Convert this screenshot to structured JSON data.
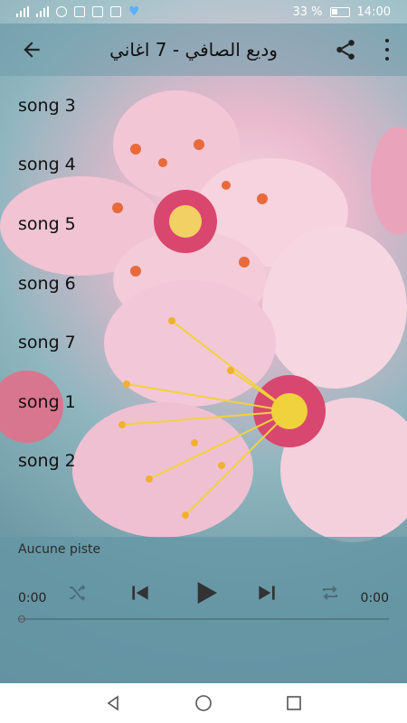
{
  "status": {
    "battery_text": "33 %",
    "time": "14:00"
  },
  "appbar": {
    "title": "وديع الصافي - 7 اغاني",
    "icons": [
      "arrow-left-icon",
      "share-icon",
      "more-vertical-icon"
    ]
  },
  "songs": [
    {
      "label": "song 3"
    },
    {
      "label": "song 4"
    },
    {
      "label": "song 5"
    },
    {
      "label": "song 6"
    },
    {
      "label": "song 7"
    },
    {
      "label": "song 1"
    },
    {
      "label": "song 2"
    }
  ],
  "player": {
    "track_label": "Aucune piste",
    "elapsed": "0:00",
    "duration": "0:00",
    "progress": 0,
    "icons": [
      "shuffle-icon",
      "skip-previous-icon",
      "play-icon",
      "skip-next-icon",
      "repeat-icon"
    ]
  },
  "navbar": {
    "icons": [
      "nav-back-icon",
      "nav-home-icon",
      "nav-recents-icon"
    ]
  },
  "colors": {
    "appbar": "#6f9baa",
    "player_bg": "#6496a5",
    "blossom_pink": "#f3c6d6",
    "stamen_yellow": "#f0d23c"
  }
}
